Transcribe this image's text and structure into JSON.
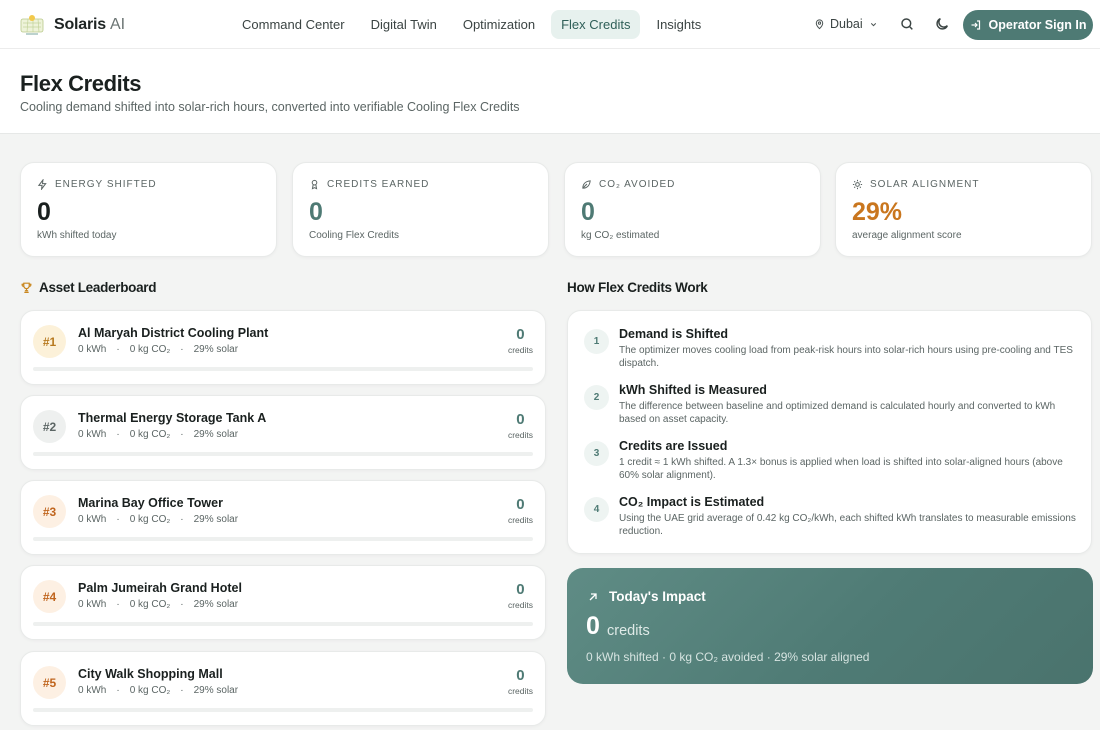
{
  "brand": {
    "name": "Solaris",
    "suffix": "AI"
  },
  "nav": {
    "links": [
      "Command Center",
      "Digital Twin",
      "Optimization",
      "Flex Credits",
      "Insights"
    ],
    "active": "Flex Credits",
    "location": "Dubai",
    "signin": "Operator Sign In"
  },
  "page": {
    "title": "Flex Credits",
    "subtitle": "Cooling demand shifted into solar-rich hours, converted into verifiable Cooling Flex Credits"
  },
  "stats": [
    {
      "label": "ENERGY SHIFTED",
      "value": "0",
      "desc": "kWh shifted today",
      "icon": "bolt-icon",
      "color": "#1a201f"
    },
    {
      "label": "CREDITS EARNED",
      "value": "0",
      "desc": "Cooling Flex Credits",
      "icon": "award-icon",
      "color": "#4e7a74"
    },
    {
      "label": "CO₂ AVOIDED",
      "value": "0",
      "desc": "kg CO₂ estimated",
      "icon": "leaf-icon",
      "color": "#4e7a74"
    },
    {
      "label": "SOLAR ALIGNMENT",
      "value": "29%",
      "desc": "average alignment score",
      "icon": "sun-icon",
      "color": "#c9761e"
    }
  ],
  "leaderboard": {
    "title": "Asset Leaderboard",
    "assets": [
      {
        "rank": "#1",
        "name": "Al Maryah District Cooling Plant",
        "kwh": "0 kWh",
        "co2": "0 kg CO₂",
        "solar": "29% solar",
        "credits": "0",
        "credits_label": "credits",
        "progress": 0
      },
      {
        "rank": "#2",
        "name": "Thermal Energy Storage Tank A",
        "kwh": "0 kWh",
        "co2": "0 kg CO₂",
        "solar": "29% solar",
        "credits": "0",
        "credits_label": "credits",
        "progress": 0
      },
      {
        "rank": "#3",
        "name": "Marina Bay Office Tower",
        "kwh": "0 kWh",
        "co2": "0 kg CO₂",
        "solar": "29% solar",
        "credits": "0",
        "credits_label": "credits",
        "progress": 0
      },
      {
        "rank": "#4",
        "name": "Palm Jumeirah Grand Hotel",
        "kwh": "0 kWh",
        "co2": "0 kg CO₂",
        "solar": "29% solar",
        "credits": "0",
        "credits_label": "credits",
        "progress": 0
      },
      {
        "rank": "#5",
        "name": "City Walk Shopping Mall",
        "kwh": "0 kWh",
        "co2": "0 kg CO₂",
        "solar": "29% solar",
        "credits": "0",
        "credits_label": "credits",
        "progress": 0
      }
    ]
  },
  "how": {
    "title": "How Flex Credits Work",
    "steps": [
      {
        "num": "1",
        "title": "Demand is Shifted",
        "desc": "The optimizer moves cooling load from peak-risk hours into solar-rich hours using pre-cooling and TES dispatch."
      },
      {
        "num": "2",
        "title": "kWh Shifted is Measured",
        "desc": "The difference between baseline and optimized demand is calculated hourly and converted to kWh based on asset capacity."
      },
      {
        "num": "3",
        "title": "Credits are Issued",
        "desc": "1 credit ≈ 1 kWh shifted. A 1.3× bonus is applied when load is shifted into solar-aligned hours (above 60% solar alignment)."
      },
      {
        "num": "4",
        "title": "CO₂ Impact is Estimated",
        "desc": "Using the UAE grid average of 0.42 kg CO₂/kWh, each shifted kWh translates to measurable emissions reduction."
      }
    ]
  },
  "impact": {
    "title": "Today's Impact",
    "value": "0",
    "unit": "credits",
    "summary": "0 kWh shifted · 0 kg CO₂ avoided · 29% solar aligned"
  }
}
